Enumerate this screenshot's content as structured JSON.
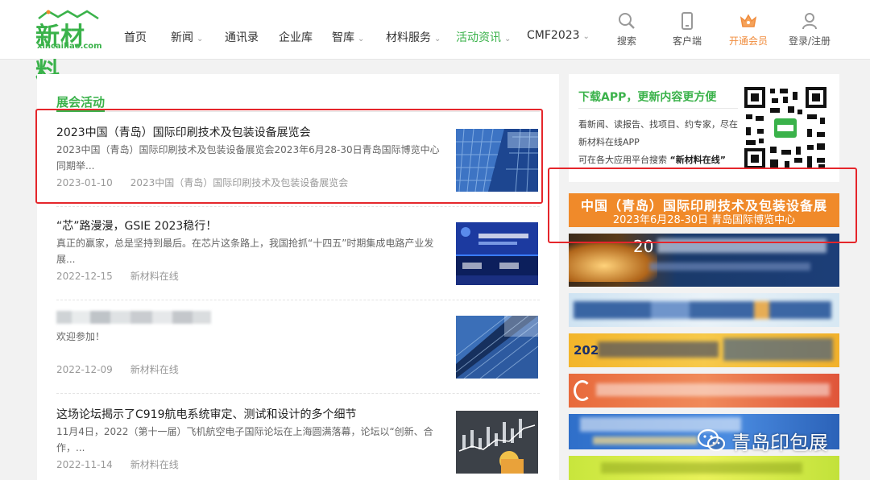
{
  "header": {
    "logo_text": "新材料",
    "logo_sub": "xincailiao.com",
    "nav": [
      {
        "label": "首页",
        "caret": ""
      },
      {
        "label": "新闻",
        "caret": "⌄"
      },
      {
        "label": "通讯录",
        "caret": ""
      },
      {
        "label": "企业库",
        "caret": ""
      },
      {
        "label": "智库",
        "caret": "⌄"
      },
      {
        "label": "材料服务",
        "caret": "⌄"
      },
      {
        "label": "活动资讯",
        "caret": "⌄"
      },
      {
        "label": "CMF2023",
        "caret": "⌄"
      }
    ],
    "tools": {
      "search": "搜索",
      "client": "客户端",
      "vip": "开通会员",
      "login": "登录/注册"
    },
    "brand_color": "#3ab24a"
  },
  "main": {
    "section_title": "展会活动",
    "articles": [
      {
        "title": "2023中国（青岛）国际印刷技术及包装设备展览会",
        "summary": "2023中国（青岛）国际印刷技术及包装设备展览会2023年6月28-30日青岛国际博览中心同期举...",
        "date": "2023-01-10",
        "source": "2023中国（青岛）国际印刷技术及包装设备展览会"
      },
      {
        "title": "“芯”路漫漫，GSIE 2023稳行！",
        "summary": "真正的赢家，总是坚持到最后。在芯片这条路上，我国抢抓“十四五”时期集成电路产业发展...",
        "date": "2022-12-15",
        "source": "新材料在线"
      },
      {
        "title": "",
        "summary": "欢迎参加！",
        "date": "2022-12-09",
        "source": "新材料在线"
      },
      {
        "title": "这场论坛揭示了C919航电系统审定、测试和设计的多个细节",
        "summary": "11月4日，2022（第十一届）飞机航空电子国际论坛在上海圆满落幕，论坛以“创新、合作，...",
        "date": "2022-11-14",
        "source": "新材料在线"
      }
    ]
  },
  "sidebar": {
    "app_title": "下载APP，更新内容更方便",
    "app_line1": "看新闻、读报告、找项目、约专家，尽在新材料在线APP",
    "app_line2_prefix": "可在各大应用平台搜索",
    "app_line2_keyword": "“新材料在线”",
    "banner_line1": "中国（青岛）国际印刷技术及包装设备展",
    "banner_line2": "2023年6月28-30日  青岛国际博览中心",
    "ad2_text": "20",
    "ad4_text": "202"
  },
  "watermark": "青岛印包展",
  "highlight_color": "#e5262b"
}
